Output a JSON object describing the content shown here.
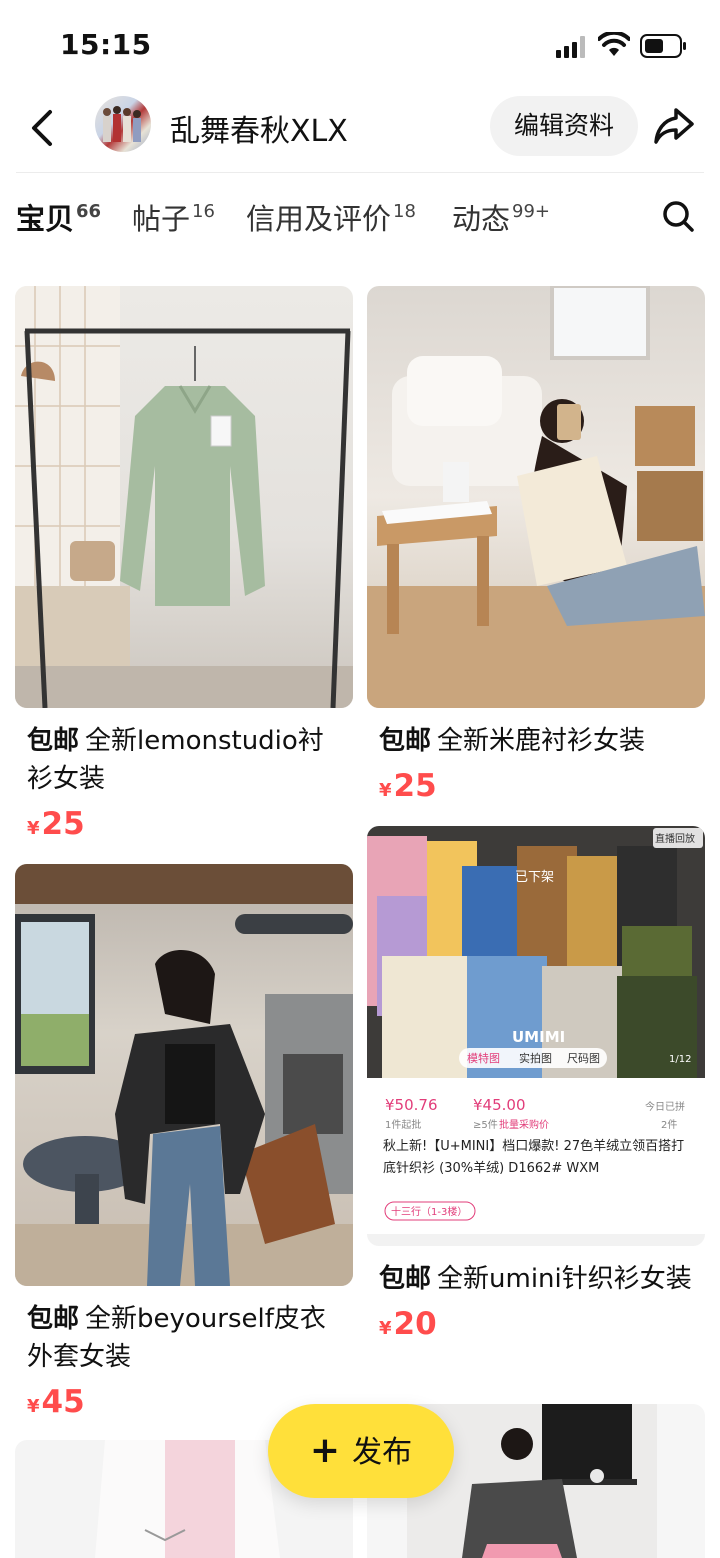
{
  "status_bar": {
    "time": "15:15"
  },
  "header": {
    "username": "乱舞春秋XLX",
    "edit_label": "编辑资料"
  },
  "tabs": [
    {
      "label": "宝贝",
      "count": "66",
      "active": true
    },
    {
      "label": "帖子",
      "count": "16",
      "active": false
    },
    {
      "label": "信用及评价",
      "count": "18",
      "active": false
    },
    {
      "label": "动态",
      "count": "99+",
      "active": false
    }
  ],
  "items": [
    {
      "badge": "包邮",
      "title": "全新lemonstudio衬衫女装",
      "currency": "¥",
      "price": "25"
    },
    {
      "badge": "包邮",
      "title": "全新米鹿衬衫女装",
      "currency": "¥",
      "price": "25"
    },
    {
      "badge": "包邮",
      "title": "全新beyourself皮衣外套女装",
      "currency": "¥",
      "price": "45"
    },
    {
      "badge": "包邮",
      "title": "全新umini针织衫女装",
      "currency": "¥",
      "price": "20"
    }
  ],
  "item4_image": {
    "tag_top_right": "直播回放",
    "unlisted": "已下架",
    "brand": "UMIMI",
    "tabs": [
      "模特图",
      "实拍图",
      "尺码图"
    ],
    "page": "1/12",
    "price1": "¥50.76",
    "price1_note": "1件起批",
    "price2": "¥45.00",
    "price2_note": "≥5件",
    "price2_tag": "批量采购价",
    "ship_note": "今日已拼",
    "ship_count": "2件",
    "desc": "秋上新!【U+MINI】档口爆款! 27色羊绒立领百搭打底针织衫 (30%羊绒) D1662# WXM",
    "stall": "十三行（1-3楼）"
  },
  "fab": {
    "label": "发布"
  },
  "colors": {
    "accent": "#ffe03a",
    "price": "#ff4c4c"
  }
}
